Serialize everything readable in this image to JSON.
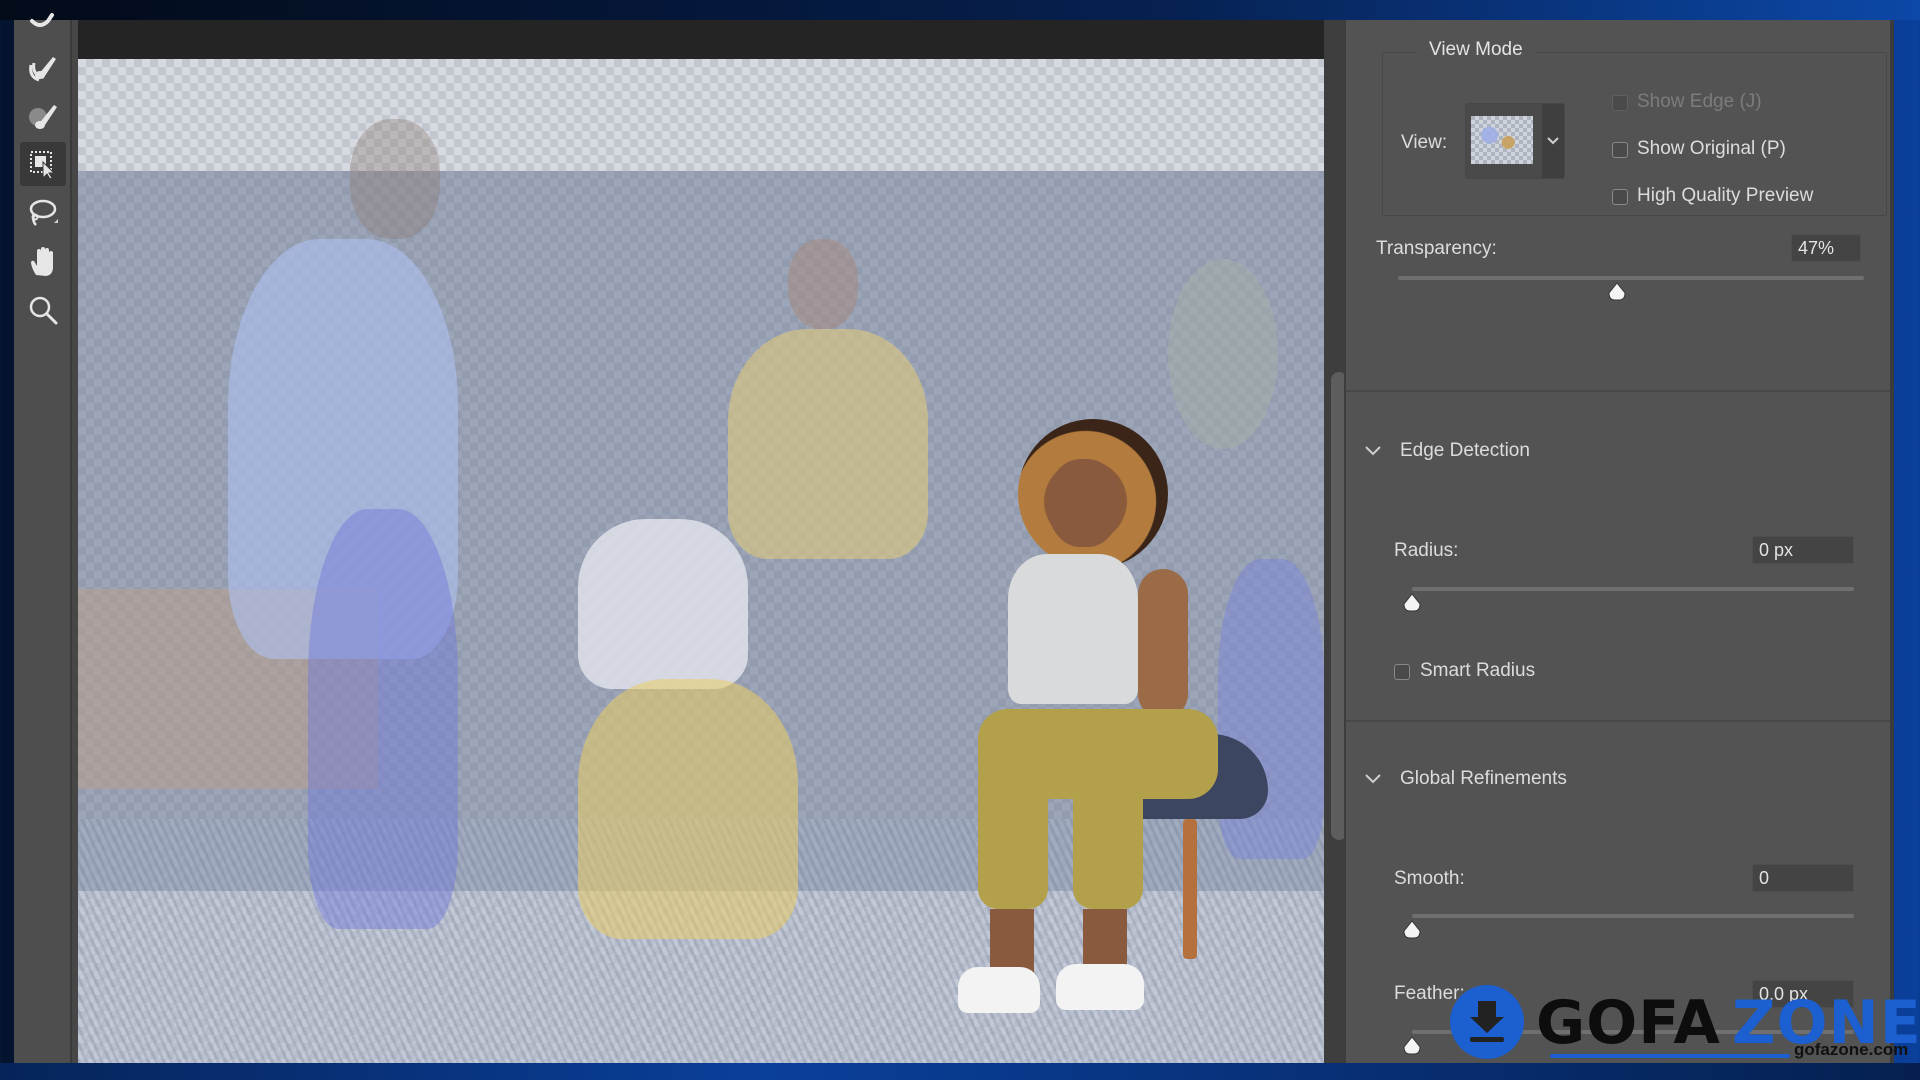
{
  "toolbar": {
    "tools": [
      {
        "name": "refine-edge-brush-tool",
        "active": false
      },
      {
        "name": "brush-tool",
        "active": false
      },
      {
        "name": "object-selection-tool",
        "active": true
      },
      {
        "name": "lasso-tool",
        "active": false
      },
      {
        "name": "hand-tool",
        "active": false
      },
      {
        "name": "zoom-tool",
        "active": false
      }
    ]
  },
  "panel": {
    "view_mode": {
      "title": "View Mode",
      "view_label": "View:",
      "show_edge": {
        "label": "Show Edge (J)",
        "checked": false,
        "enabled": false
      },
      "show_original": {
        "label": "Show Original (P)",
        "checked": false
      },
      "high_quality_preview": {
        "label": "High Quality Preview",
        "checked": false
      }
    },
    "transparency": {
      "label": "Transparency:",
      "value": "47%",
      "fraction": 0.47
    },
    "edge_detection": {
      "title": "Edge Detection",
      "radius": {
        "label": "Radius:",
        "value": "0 px",
        "fraction": 0
      },
      "smart_radius": {
        "label": "Smart Radius",
        "checked": false
      }
    },
    "global_refinements": {
      "title": "Global Refinements",
      "smooth": {
        "label": "Smooth:",
        "value": "0",
        "fraction": 0
      },
      "feather": {
        "label": "Feather:",
        "value": "0.0 px",
        "fraction": 0
      }
    }
  },
  "watermark": {
    "brand_a": "GOFA",
    "brand_b": "ZONE",
    "url": "gofazone.com",
    "color": "#1c5fd0"
  }
}
